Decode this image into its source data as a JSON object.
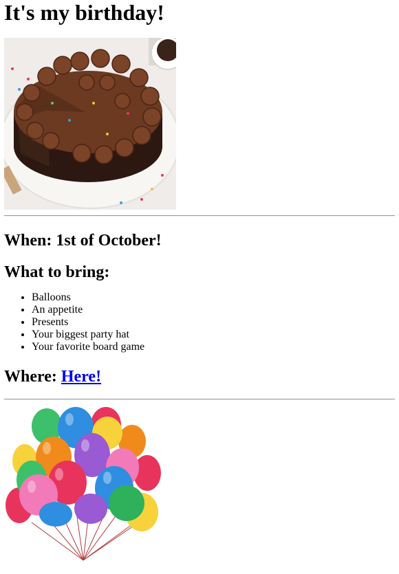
{
  "page": {
    "title": "It's my birthday!",
    "when": "When: 1st of October!",
    "bring_title": "What to bring:",
    "bring_items": [
      "Balloons",
      "An appetite",
      "Presents",
      "Your biggest party hat",
      "Your favorite board game"
    ],
    "where_label": "Where: ",
    "where_link": "Here!"
  },
  "colors": {
    "link": "#0000ee",
    "rule": "#9a9a9a",
    "cake_frosting": "#6b3a21",
    "cake_sponge": "#2e1a10",
    "plate": "#f2f0ec"
  }
}
